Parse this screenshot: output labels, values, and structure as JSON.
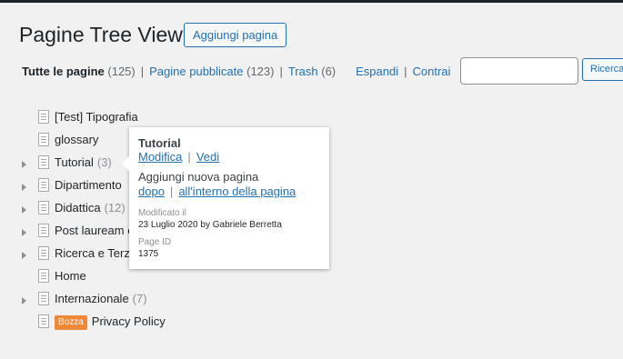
{
  "header": {
    "title": "Pagine Tree View",
    "add_button": "Aggiungi pagina"
  },
  "filters": {
    "all": {
      "label": "Tutte le pagine",
      "count": "(125)"
    },
    "published": {
      "label": "Pagine pubblicate",
      "count": "(123)"
    },
    "trash": {
      "label": "Trash",
      "count": "(6)"
    },
    "expand": "Espandi",
    "collapse": "Contrai",
    "separator": "|"
  },
  "search": {
    "value": "",
    "button": "Ricerca"
  },
  "tree": {
    "items": [
      {
        "title": "[Test] Tipografia",
        "count": "",
        "has_children": false,
        "badge": ""
      },
      {
        "title": "glossary",
        "count": "",
        "has_children": false,
        "badge": ""
      },
      {
        "title": "Tutorial",
        "count": "(3)",
        "has_children": true,
        "badge": ""
      },
      {
        "title": "Dipartimento",
        "count": "",
        "has_children": true,
        "badge": ""
      },
      {
        "title": "Didattica",
        "count": "(12)",
        "has_children": true,
        "badge": ""
      },
      {
        "title": "Post lauream e",
        "count": "",
        "has_children": true,
        "badge": ""
      },
      {
        "title": "Ricerca e Terza",
        "count": "",
        "has_children": true,
        "badge": ""
      },
      {
        "title": "Home",
        "count": "",
        "has_children": false,
        "badge": ""
      },
      {
        "title": "Internazionale",
        "count": "(7)",
        "has_children": true,
        "badge": ""
      },
      {
        "title": "Privacy Policy",
        "count": "",
        "has_children": false,
        "badge": "Bozza"
      }
    ]
  },
  "popup": {
    "title": "Tutorial",
    "edit": "Modifica",
    "view": "Vedi",
    "add_new": "Aggiungi nuova pagina",
    "after": "dopo",
    "inside": "all'interno della pagina",
    "modified_label": "Modificato il",
    "modified_value": "23 Luglio 2020 by Gabriele Berretta",
    "page_id_label": "Page ID",
    "page_id_value": "1375"
  }
}
